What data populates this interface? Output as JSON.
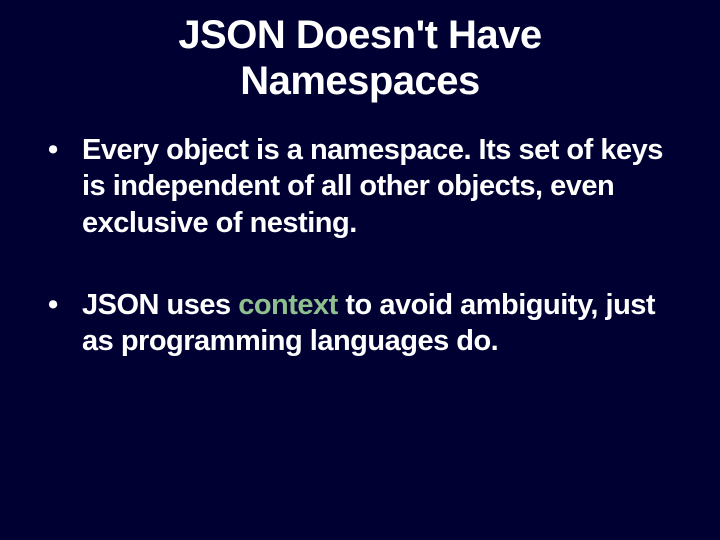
{
  "title": "JSON Doesn't Have Namespaces",
  "bullets": [
    {
      "text": "Every object is a namespace. Its set of keys is independent of all other objects, even exclusive of nesting."
    },
    {
      "pre": "JSON uses ",
      "hl": "context",
      "post": " to avoid ambiguity, just as programming languages do."
    }
  ]
}
